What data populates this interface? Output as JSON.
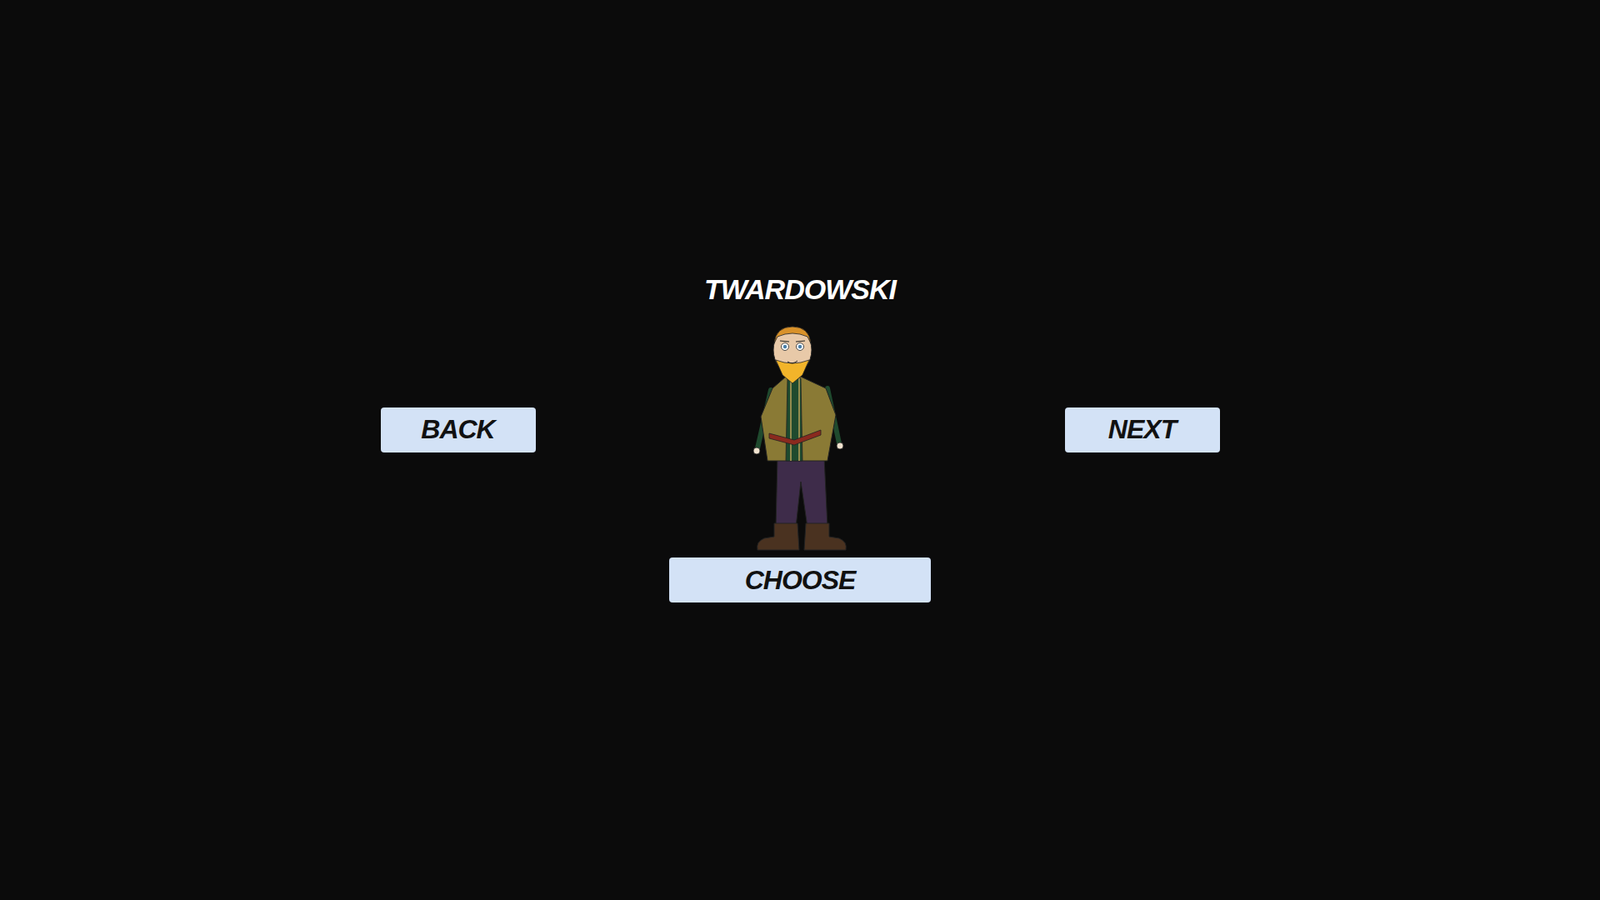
{
  "character": {
    "name": "TWARDOWSKI"
  },
  "buttons": {
    "back": "BACK",
    "next": "NEXT",
    "choose": "CHOOSE"
  }
}
